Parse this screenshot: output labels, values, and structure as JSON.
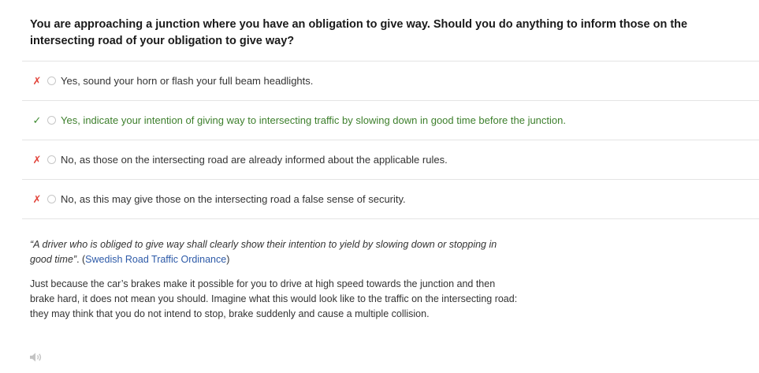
{
  "question": {
    "text": "You are approaching a junction where you have an obligation to give way. Should you do anything to inform those on the intersecting road of your obligation to give way?"
  },
  "options": [
    {
      "mark": "✗",
      "status": "wrong",
      "text": "Yes, sound your horn or flash your full beam headlights."
    },
    {
      "mark": "✓",
      "status": "correct",
      "text": "Yes, indicate your intention of giving way to intersecting traffic by slowing down in good time before the junction."
    },
    {
      "mark": "✗",
      "status": "wrong",
      "text": "No, as those on the intersecting road are already informed about the applicable rules."
    },
    {
      "mark": "✗",
      "status": "wrong",
      "text": "No, as this may give those on the intersecting road a false sense of security."
    }
  ],
  "explanation": {
    "quote_text": "“A driver who is obliged to give way shall clearly show their intention to yield by slowing down or stopping in good time”",
    "quote_suffix_open": ". (",
    "quote_link": "Swedish Road Traffic Ordinance",
    "quote_suffix_close": ")",
    "paragraph": "Just because the car’s brakes make it possible for you to drive at high speed towards the junction and then brake hard, it does not mean you should. Imagine what this would look like to the traffic on the intersecting road: they may think that you do not intend to stop, brake suddenly and cause a multiple collision."
  },
  "icons": {
    "audio": "speaker-icon"
  },
  "colors": {
    "wrong": "#e2443b",
    "correct": "#3d7f2c",
    "link": "#2d5aa8"
  }
}
